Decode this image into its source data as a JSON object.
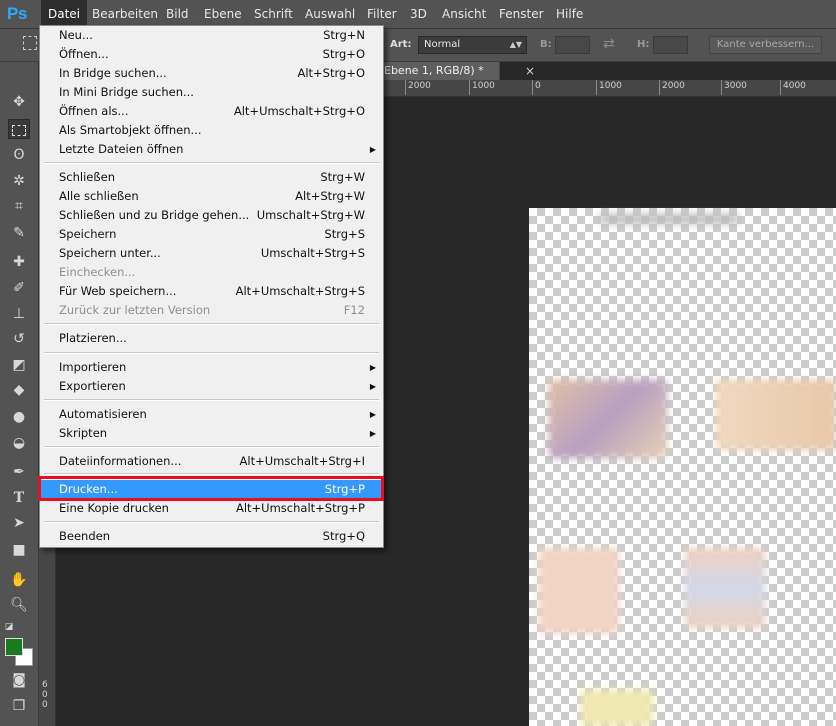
{
  "app": {
    "logo": "Ps"
  },
  "menubar": [
    "Datei",
    "Bearbeiten",
    "Bild",
    "Ebene",
    "Schrift",
    "Auswahl",
    "Filter",
    "3D",
    "Ansicht",
    "Fenster",
    "Hilfe"
  ],
  "options": {
    "art_label": "Art:",
    "art_value": "Normal",
    "b_label": "B:",
    "h_label": "H:",
    "refine_label": "Kante verbessern..."
  },
  "document": {
    "tab_label": "Ebene 1, RGB/8) *",
    "close": "×"
  },
  "ruler": {
    "h_labels": [
      "2000",
      "1000",
      "0",
      "1000",
      "2000",
      "3000",
      "4000"
    ],
    "v_label": "600"
  },
  "menu": {
    "items": [
      {
        "label": "Neu...",
        "shortcut": "Strg+N"
      },
      {
        "label": "Öffnen...",
        "shortcut": "Strg+O"
      },
      {
        "label": "In Bridge suchen...",
        "shortcut": "Alt+Strg+O"
      },
      {
        "label": "In Mini Bridge suchen...",
        "shortcut": ""
      },
      {
        "label": "Öffnen als...",
        "shortcut": "Alt+Umschalt+Strg+O"
      },
      {
        "label": "Als Smartobjekt öffnen...",
        "shortcut": ""
      },
      {
        "label": "Letzte Dateien öffnen",
        "shortcut": ""
      },
      {
        "label": "Schließen",
        "shortcut": "Strg+W"
      },
      {
        "label": "Alle schließen",
        "shortcut": "Alt+Strg+W"
      },
      {
        "label": "Schließen und zu Bridge gehen...",
        "shortcut": "Umschalt+Strg+W"
      },
      {
        "label": "Speichern",
        "shortcut": "Strg+S"
      },
      {
        "label": "Speichern unter...",
        "shortcut": "Umschalt+Strg+S"
      },
      {
        "label": "Einchecken...",
        "shortcut": ""
      },
      {
        "label": "Für Web speichern...",
        "shortcut": "Alt+Umschalt+Strg+S"
      },
      {
        "label": "Zurück zur letzten Version",
        "shortcut": "F12"
      },
      {
        "label": "Platzieren...",
        "shortcut": ""
      },
      {
        "label": "Importieren",
        "shortcut": ""
      },
      {
        "label": "Exportieren",
        "shortcut": ""
      },
      {
        "label": "Automatisieren",
        "shortcut": ""
      },
      {
        "label": "Skripten",
        "shortcut": ""
      },
      {
        "label": "Dateiinformationen...",
        "shortcut": "Alt+Umschalt+Strg+I"
      },
      {
        "label": "Drucken...",
        "shortcut": "Strg+P"
      },
      {
        "label": "Eine Kopie drucken",
        "shortcut": "Alt+Umschalt+Strg+P"
      },
      {
        "label": "Beenden",
        "shortcut": "Strg+Q"
      }
    ]
  },
  "colors": {
    "accent": "#31a8ff",
    "highlight": "#3399ff",
    "callout": "#e8101a",
    "foreground": "#1b7a1e",
    "background": "#ffffff"
  }
}
